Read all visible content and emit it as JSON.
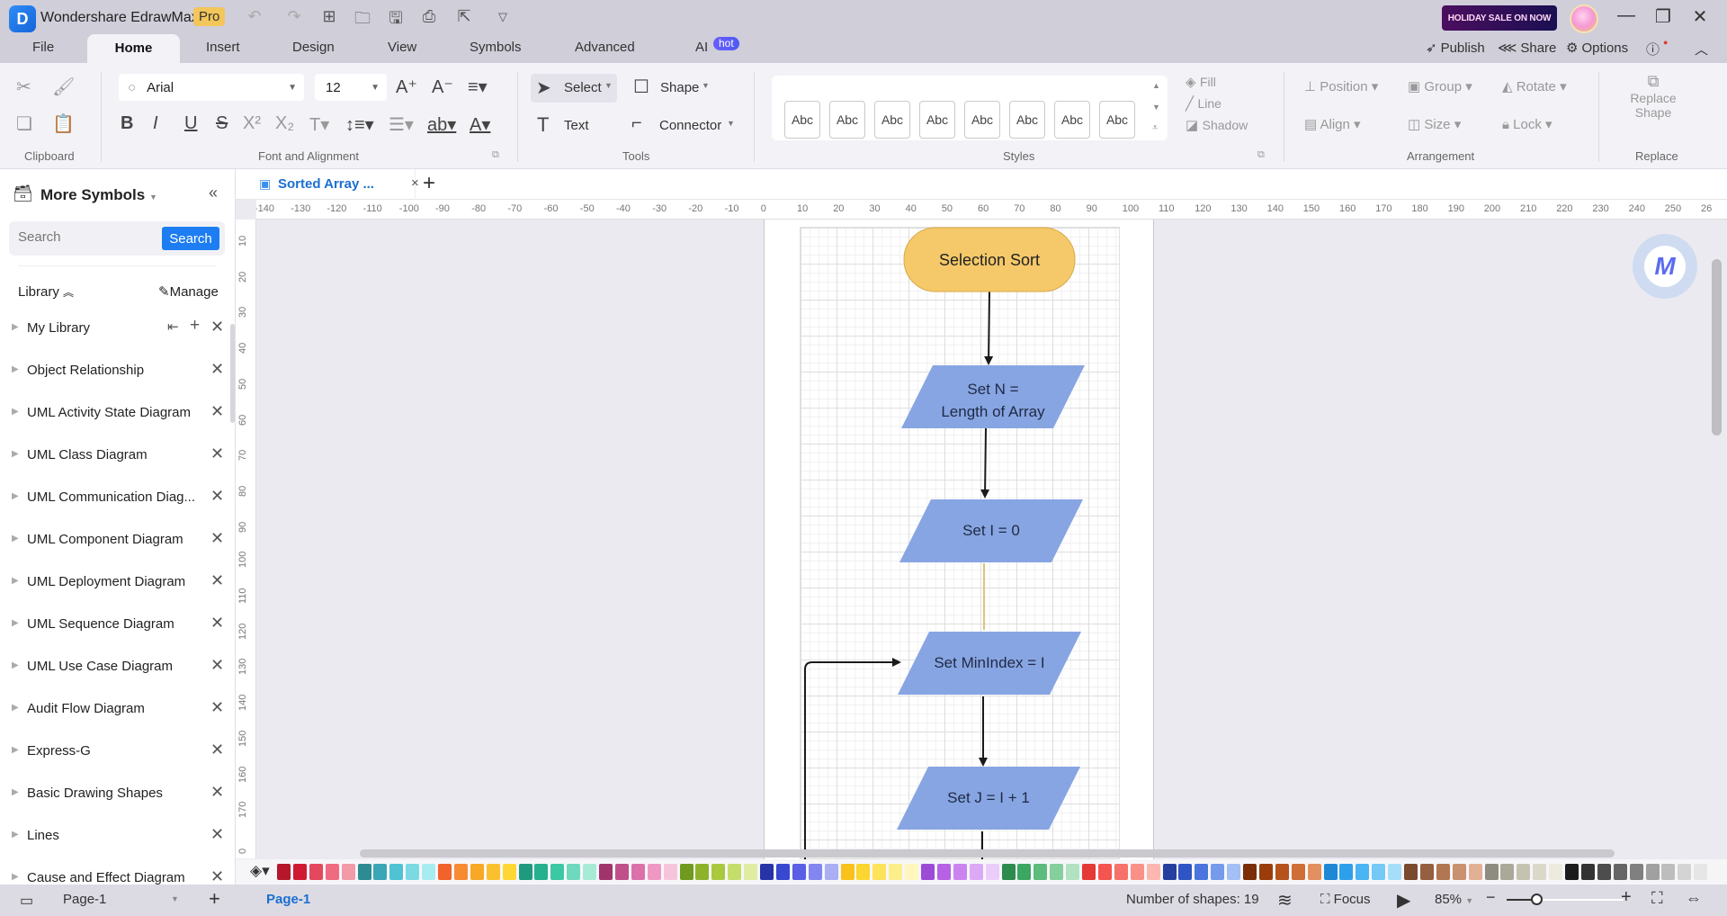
{
  "app": {
    "title": "Wondershare EdrawMax",
    "badge": "Pro",
    "sale_banner": "HOLIDAY SALE ON NOW"
  },
  "menu_tabs": [
    {
      "label": "File"
    },
    {
      "label": "Home",
      "active": true
    },
    {
      "label": "Insert"
    },
    {
      "label": "Design"
    },
    {
      "label": "View"
    },
    {
      "label": "Symbols"
    },
    {
      "label": "Advanced"
    },
    {
      "label": "AI",
      "badge": "hot"
    }
  ],
  "top_right": {
    "publish": "Publish",
    "share": "Share",
    "options": "Options"
  },
  "ribbon": {
    "font": {
      "family": "Arial",
      "size": "12"
    },
    "tools": {
      "select": "Select",
      "shape": "Shape",
      "text": "Text",
      "connector": "Connector"
    },
    "style_samples": [
      "Abc",
      "Abc",
      "Abc",
      "Abc",
      "Abc",
      "Abc",
      "Abc",
      "Abc"
    ],
    "style_options": {
      "fill": "Fill",
      "line": "Line",
      "shadow": "Shadow"
    },
    "arrangement": {
      "position": "Position",
      "group": "Group",
      "rotate": "Rotate",
      "align": "Align",
      "size": "Size",
      "lock": "Lock"
    },
    "replace": {
      "line1": "Replace",
      "line2": "Shape"
    },
    "groups": {
      "clipboard": "Clipboard",
      "font": "Font and Alignment",
      "tools": "Tools",
      "styles": "Styles",
      "arrangement": "Arrangement",
      "replace": "Replace"
    }
  },
  "sidebar": {
    "title": "More Symbols",
    "search": {
      "placeholder": "Search",
      "button": "Search"
    },
    "library_label": "Library",
    "manage_label": "Manage",
    "libraries": [
      "My Library",
      "Object Relationship",
      "UML Activity State Diagram",
      "UML Class Diagram",
      "UML Communication Diag...",
      "UML Component Diagram",
      "UML Deployment Diagram",
      "UML Sequence Diagram",
      "UML Use Case Diagram",
      "Audit Flow Diagram",
      "Express-G",
      "Basic Drawing Shapes",
      "Lines",
      "Cause and Effect Diagram"
    ]
  },
  "document": {
    "tab_title": "Sorted Array ..."
  },
  "rulers": {
    "horizontal": [
      "-140",
      "-130",
      "-120",
      "-110",
      "-100",
      "-90",
      "-80",
      "-70",
      "-60",
      "-50",
      "-40",
      "-30",
      "-20",
      "-10",
      "0",
      "10",
      "20",
      "30",
      "40",
      "50",
      "60",
      "70",
      "80",
      "90",
      "100",
      "110",
      "120",
      "130",
      "140",
      "150",
      "160",
      "170",
      "180",
      "190",
      "200",
      "210",
      "220",
      "230",
      "240",
      "250",
      "26"
    ],
    "vertical": [
      "10",
      "20",
      "30",
      "40",
      "50",
      "60",
      "70",
      "80",
      "90",
      "100",
      "110",
      "120",
      "130",
      "140",
      "150",
      "160",
      "170",
      "0"
    ]
  },
  "flowchart": {
    "start": "Selection Sort",
    "steps": [
      {
        "line1": "Set N =",
        "line2": "Length of Array"
      },
      {
        "line1": "Set I = 0"
      },
      {
        "line1": "Set MinIndex = I"
      },
      {
        "line1": "Set J = I + 1"
      }
    ],
    "colors": {
      "terminator": "#f5c96a",
      "process": "#87a5e2",
      "connector": "#1a1a1a",
      "selected_connector": "#d4b04a"
    }
  },
  "palette": [
    "#b5182b",
    "#d01a32",
    "#e5475f",
    "#f06a80",
    "#f39aa8",
    "#2e8b93",
    "#3aa6b6",
    "#4fc3d3",
    "#7ad9e3",
    "#a8ecf1",
    "#f2622b",
    "#f78b31",
    "#f9a825",
    "#fbc02d",
    "#fdd835",
    "#1e9a7e",
    "#26b08f",
    "#3dc8a5",
    "#6fd9bd",
    "#a7ebd6",
    "#a2346c",
    "#c0508a",
    "#dc70a8",
    "#ef98c4",
    "#f6c5dc",
    "#6f9a1f",
    "#8db32a",
    "#a9c93f",
    "#c5dd6b",
    "#dfeca1",
    "#2634a7",
    "#3848d1",
    "#5a5fe5",
    "#8286ee",
    "#aaaef3",
    "#f8c21b",
    "#fbd530",
    "#fde35a",
    "#feee8b",
    "#fff7bd",
    "#9b4bd5",
    "#b562e5",
    "#cb84ef",
    "#dcaaf5",
    "#ebcdfa",
    "#2e8b4e",
    "#3ca663",
    "#5dbb7c",
    "#85cf9d",
    "#b1e2c1",
    "#e53935",
    "#f4554f",
    "#f6716a",
    "#f99189",
    "#fbb7b0",
    "#253f9e",
    "#2f55c4",
    "#4b74df",
    "#759bea",
    "#a3bff3",
    "#7a2d06",
    "#9a3d0b",
    "#b6521b",
    "#cf6e37",
    "#e39060",
    "#1e88d5",
    "#2ca0ea",
    "#4ab5f2",
    "#74c9f7",
    "#a6def9",
    "#7a4a2e",
    "#965f3f",
    "#b07752",
    "#c99170",
    "#e2b195",
    "#8e8c80",
    "#aaa898",
    "#c4c2b1",
    "#dad8c8",
    "#ecebdd",
    "#1c1c1c",
    "#333333",
    "#4d4d4d",
    "#666666",
    "#808080",
    "#a0a0a0",
    "#bdbdbd",
    "#d4d4d4",
    "#e6e6e6",
    "#f5f5f5"
  ],
  "status": {
    "page_select": "Page-1",
    "page_tab": "Page-1",
    "shapes": "Number of shapes: 19",
    "focus": "Focus",
    "zoom": "85%",
    "zoom_fraction": 0.25
  }
}
